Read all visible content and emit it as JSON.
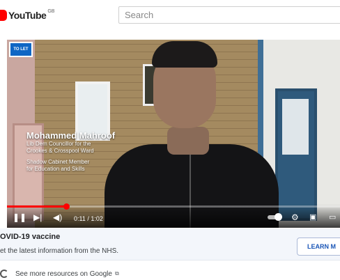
{
  "header": {
    "logo_text": "YouTube",
    "region": "GB",
    "search_placeholder": "Search"
  },
  "video": {
    "sign_text": "TO LET",
    "caption_name": "Mohammed Mahroof",
    "caption_lines": [
      "Lib Dem Councillor for the",
      "Crookes & Crosspool Ward"
    ],
    "caption_lines2": [
      "Shadow Cabinet Member",
      "for Education and Skills"
    ],
    "time_display": "0:11 / 1:02",
    "progress": 0.177
  },
  "info_panel": {
    "title": "OVID-19 vaccine",
    "subtitle": "et the latest information from the NHS.",
    "button_label": "LEARN M"
  },
  "more_resources": {
    "text": "See more resources on Google"
  },
  "colors": {
    "progress": "#ff0000",
    "button_text": "#1a56b7",
    "panel_bg": "#f3f6fb"
  }
}
